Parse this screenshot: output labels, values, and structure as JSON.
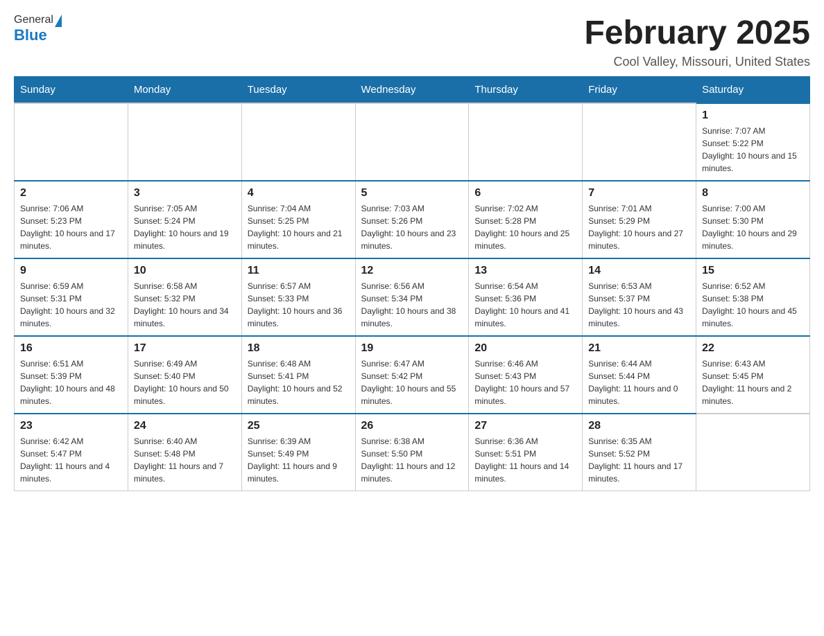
{
  "logo": {
    "text_general": "General",
    "text_blue": "Blue"
  },
  "title": "February 2025",
  "location": "Cool Valley, Missouri, United States",
  "weekdays": [
    "Sunday",
    "Monday",
    "Tuesday",
    "Wednesday",
    "Thursday",
    "Friday",
    "Saturday"
  ],
  "weeks": [
    [
      {
        "day": "",
        "info": ""
      },
      {
        "day": "",
        "info": ""
      },
      {
        "day": "",
        "info": ""
      },
      {
        "day": "",
        "info": ""
      },
      {
        "day": "",
        "info": ""
      },
      {
        "day": "",
        "info": ""
      },
      {
        "day": "1",
        "info": "Sunrise: 7:07 AM\nSunset: 5:22 PM\nDaylight: 10 hours and 15 minutes."
      }
    ],
    [
      {
        "day": "2",
        "info": "Sunrise: 7:06 AM\nSunset: 5:23 PM\nDaylight: 10 hours and 17 minutes."
      },
      {
        "day": "3",
        "info": "Sunrise: 7:05 AM\nSunset: 5:24 PM\nDaylight: 10 hours and 19 minutes."
      },
      {
        "day": "4",
        "info": "Sunrise: 7:04 AM\nSunset: 5:25 PM\nDaylight: 10 hours and 21 minutes."
      },
      {
        "day": "5",
        "info": "Sunrise: 7:03 AM\nSunset: 5:26 PM\nDaylight: 10 hours and 23 minutes."
      },
      {
        "day": "6",
        "info": "Sunrise: 7:02 AM\nSunset: 5:28 PM\nDaylight: 10 hours and 25 minutes."
      },
      {
        "day": "7",
        "info": "Sunrise: 7:01 AM\nSunset: 5:29 PM\nDaylight: 10 hours and 27 minutes."
      },
      {
        "day": "8",
        "info": "Sunrise: 7:00 AM\nSunset: 5:30 PM\nDaylight: 10 hours and 29 minutes."
      }
    ],
    [
      {
        "day": "9",
        "info": "Sunrise: 6:59 AM\nSunset: 5:31 PM\nDaylight: 10 hours and 32 minutes."
      },
      {
        "day": "10",
        "info": "Sunrise: 6:58 AM\nSunset: 5:32 PM\nDaylight: 10 hours and 34 minutes."
      },
      {
        "day": "11",
        "info": "Sunrise: 6:57 AM\nSunset: 5:33 PM\nDaylight: 10 hours and 36 minutes."
      },
      {
        "day": "12",
        "info": "Sunrise: 6:56 AM\nSunset: 5:34 PM\nDaylight: 10 hours and 38 minutes."
      },
      {
        "day": "13",
        "info": "Sunrise: 6:54 AM\nSunset: 5:36 PM\nDaylight: 10 hours and 41 minutes."
      },
      {
        "day": "14",
        "info": "Sunrise: 6:53 AM\nSunset: 5:37 PM\nDaylight: 10 hours and 43 minutes."
      },
      {
        "day": "15",
        "info": "Sunrise: 6:52 AM\nSunset: 5:38 PM\nDaylight: 10 hours and 45 minutes."
      }
    ],
    [
      {
        "day": "16",
        "info": "Sunrise: 6:51 AM\nSunset: 5:39 PM\nDaylight: 10 hours and 48 minutes."
      },
      {
        "day": "17",
        "info": "Sunrise: 6:49 AM\nSunset: 5:40 PM\nDaylight: 10 hours and 50 minutes."
      },
      {
        "day": "18",
        "info": "Sunrise: 6:48 AM\nSunset: 5:41 PM\nDaylight: 10 hours and 52 minutes."
      },
      {
        "day": "19",
        "info": "Sunrise: 6:47 AM\nSunset: 5:42 PM\nDaylight: 10 hours and 55 minutes."
      },
      {
        "day": "20",
        "info": "Sunrise: 6:46 AM\nSunset: 5:43 PM\nDaylight: 10 hours and 57 minutes."
      },
      {
        "day": "21",
        "info": "Sunrise: 6:44 AM\nSunset: 5:44 PM\nDaylight: 11 hours and 0 minutes."
      },
      {
        "day": "22",
        "info": "Sunrise: 6:43 AM\nSunset: 5:45 PM\nDaylight: 11 hours and 2 minutes."
      }
    ],
    [
      {
        "day": "23",
        "info": "Sunrise: 6:42 AM\nSunset: 5:47 PM\nDaylight: 11 hours and 4 minutes."
      },
      {
        "day": "24",
        "info": "Sunrise: 6:40 AM\nSunset: 5:48 PM\nDaylight: 11 hours and 7 minutes."
      },
      {
        "day": "25",
        "info": "Sunrise: 6:39 AM\nSunset: 5:49 PM\nDaylight: 11 hours and 9 minutes."
      },
      {
        "day": "26",
        "info": "Sunrise: 6:38 AM\nSunset: 5:50 PM\nDaylight: 11 hours and 12 minutes."
      },
      {
        "day": "27",
        "info": "Sunrise: 6:36 AM\nSunset: 5:51 PM\nDaylight: 11 hours and 14 minutes."
      },
      {
        "day": "28",
        "info": "Sunrise: 6:35 AM\nSunset: 5:52 PM\nDaylight: 11 hours and 17 minutes."
      },
      {
        "day": "",
        "info": ""
      }
    ]
  ]
}
